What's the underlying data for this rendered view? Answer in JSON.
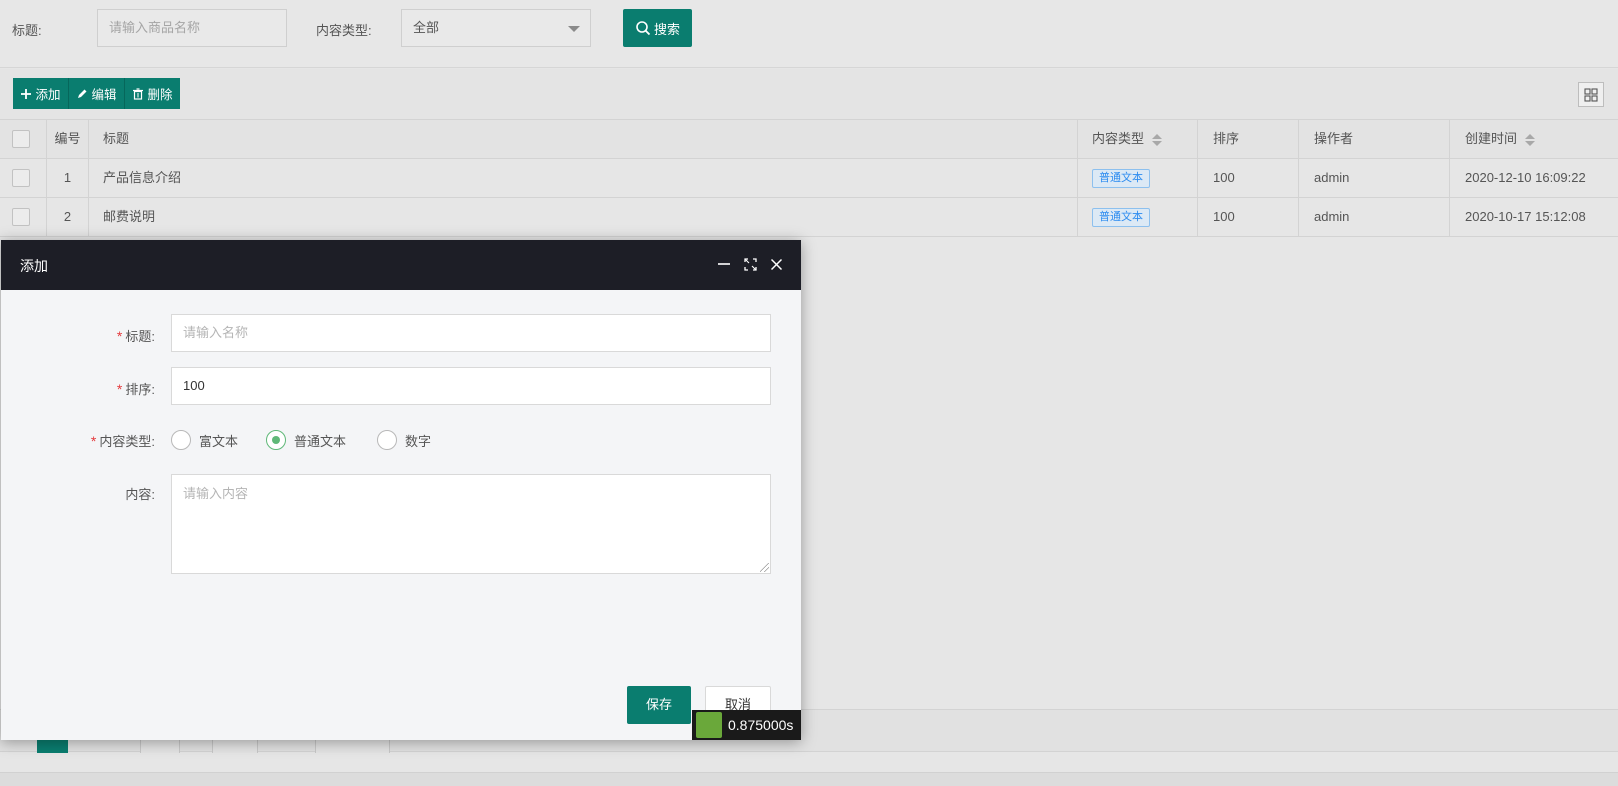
{
  "search": {
    "title_label": "标题:",
    "title_placeholder": "请输入商品名称",
    "type_label": "内容类型:",
    "type_value": "全部",
    "search_label": "搜索"
  },
  "toolbar": {
    "add_label": "添加",
    "edit_label": "编辑",
    "delete_label": "删除"
  },
  "table": {
    "headers": {
      "id": "编号",
      "title": "标题",
      "type": "内容类型",
      "sort": "排序",
      "operator": "操作者",
      "created": "创建时间"
    },
    "rows": [
      {
        "id": "1",
        "title": "产品信息介绍",
        "type": "普通文本",
        "sort": "100",
        "operator": "admin",
        "created": "2020-12-10 16:09:22"
      },
      {
        "id": "2",
        "title": "邮费说明",
        "type": "普通文本",
        "sort": "100",
        "operator": "admin",
        "created": "2020-10-17 15:12:08"
      }
    ]
  },
  "modal": {
    "title": "添加",
    "required_mark": "*",
    "title_label": "标题:",
    "title_placeholder": "请输入名称",
    "sort_label": "排序:",
    "sort_value": "100",
    "type_label": "内容类型:",
    "type_options": [
      "富文本",
      "普通文本",
      "数字"
    ],
    "type_selected": "普通文本",
    "content_label": "内容:",
    "content_placeholder": "请输入内容",
    "save_label": "保存",
    "cancel_label": "取消"
  },
  "timer": {
    "text": "0.875000s"
  },
  "colors": {
    "primary": "#0a7d6f",
    "dialog_header": "#1d1e26",
    "radio_checked": "#5fb878",
    "tag_blue": "#2d8cf0",
    "required": "#e4393c"
  },
  "icons": [
    "search-icon",
    "plus-icon",
    "pencil-icon",
    "trash-icon",
    "columns-icon",
    "minimize-icon",
    "maximize-icon",
    "close-icon",
    "chevron-down-icon",
    "sort-icon"
  ]
}
